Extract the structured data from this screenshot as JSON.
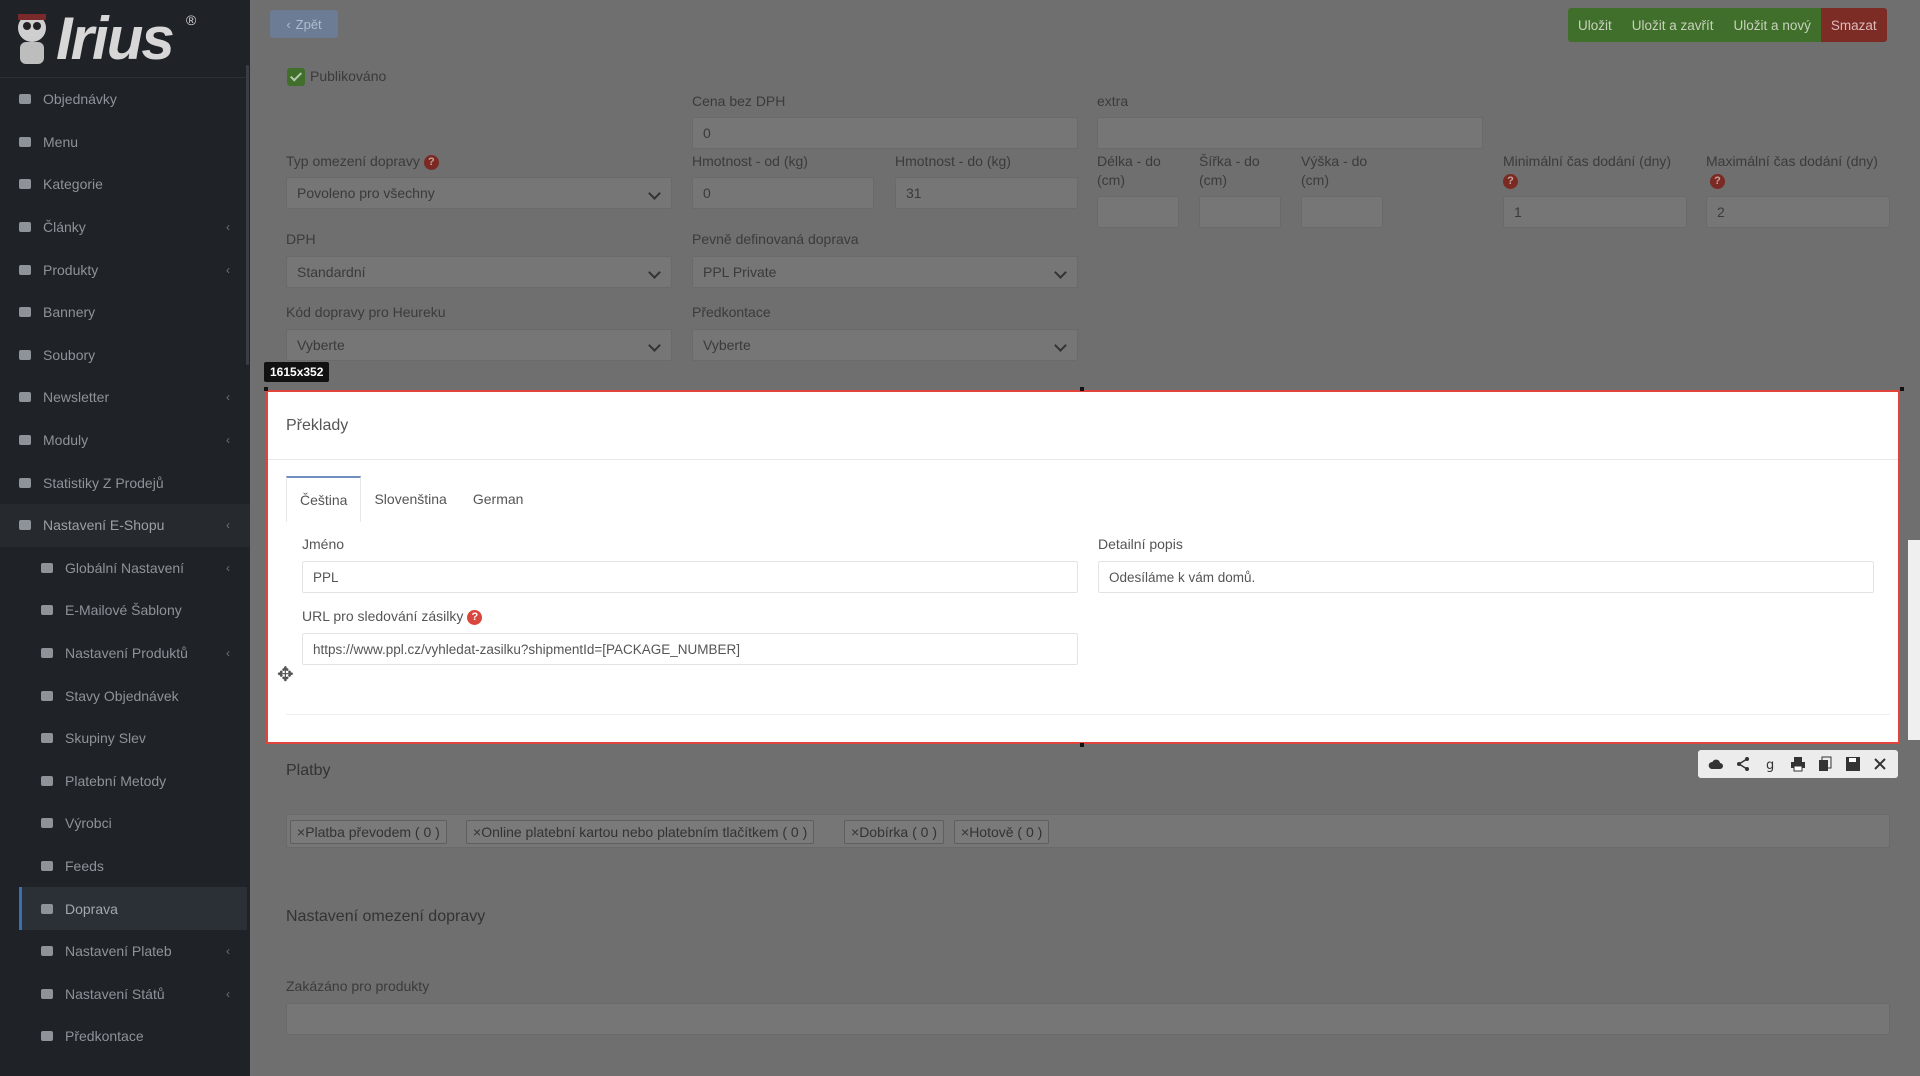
{
  "logo": {
    "text": "Irius",
    "reg": "®"
  },
  "sidebar": {
    "items": [
      {
        "label": "Objednávky",
        "icon": "cart-icon",
        "chevron": false
      },
      {
        "label": "Menu",
        "icon": "folder-icon",
        "chevron": false
      },
      {
        "label": "Kategorie",
        "icon": "list-icon",
        "chevron": false
      },
      {
        "label": "Články",
        "icon": "pencil-icon",
        "chevron": true
      },
      {
        "label": "Produkty",
        "icon": "dribbble-icon",
        "chevron": true
      },
      {
        "label": "Bannery",
        "icon": "image-icon",
        "chevron": false
      },
      {
        "label": "Soubory",
        "icon": "file-icon",
        "chevron": false
      },
      {
        "label": "Newsletter",
        "icon": "envelope-circle-icon",
        "chevron": true
      },
      {
        "label": "Moduly",
        "icon": "puzzle-icon",
        "chevron": true
      },
      {
        "label": "Statistiky Z Prodejů",
        "icon": "chart-icon",
        "chevron": false
      },
      {
        "label": "Nastavení E-Shopu",
        "icon": "settings-icon",
        "chevron": true
      }
    ],
    "subitems": [
      {
        "label": "Globální Nastavení",
        "icon": "gear-icon",
        "chevron": true
      },
      {
        "label": "E-Mailové Šablony",
        "icon": "mail-icon",
        "chevron": false
      },
      {
        "label": "Nastavení Produktů",
        "icon": "dribbble-icon",
        "chevron": true
      },
      {
        "label": "Stavy Objednávek",
        "icon": "flask-icon",
        "chevron": false
      },
      {
        "label": "Skupiny Slev",
        "icon": "tag-icon",
        "chevron": false
      },
      {
        "label": "Platební Metody",
        "icon": "card-icon",
        "chevron": false
      },
      {
        "label": "Výrobci",
        "icon": "building-icon",
        "chevron": false
      },
      {
        "label": "Feeds",
        "icon": "rss-icon",
        "chevron": false
      },
      {
        "label": "Doprava",
        "icon": "truck-icon",
        "chevron": false
      },
      {
        "label": "Nastavení Plateb",
        "icon": "card-icon",
        "chevron": true
      },
      {
        "label": "Nastavení Států",
        "icon": "flag-icon",
        "chevron": true
      },
      {
        "label": "Předkontace",
        "icon": "file-icon",
        "chevron": false
      }
    ]
  },
  "header": {
    "back_label": "Zpět",
    "actions": {
      "save": "Uložit",
      "save_close": "Uložit a zavřít",
      "save_new": "Uložit a nový",
      "delete": "Smazat"
    }
  },
  "form": {
    "published_label": "Publikováno",
    "price_label": "Cena bez DPH",
    "price_value": "0",
    "extra_label": "extra",
    "extra_value": "",
    "restriction_label": "Typ omezení dopravy",
    "restriction_value": "Povoleno pro všechny",
    "weight_from_label": "Hmotnost - od (kg)",
    "weight_from_value": "0",
    "weight_to_label": "Hmotnost - do (kg)",
    "weight_to_value": "31",
    "length_label": "Délka - do (cm)",
    "width_label": "Šířka - do (cm)",
    "height_label": "Výška - do (cm)",
    "min_time_label": "Minimální čas dodání (dny)",
    "min_time_value": "1",
    "max_time_label": "Maximální čas dodání (dny)",
    "max_time_value": "2",
    "vat_label": "DPH",
    "vat_value": "Standardní",
    "fixed_label": "Pevně definovaná doprava",
    "fixed_value": "PPL Private",
    "heureka_label": "Kód dopravy pro Heureku",
    "heureka_value": "Vyberte",
    "precontact_label": "Předkontace",
    "precontact_value": "Vyberte"
  },
  "overlay": {
    "size": "1615x352"
  },
  "translations": {
    "title": "Překlady",
    "tabs": [
      "Čeština",
      "Slovenština",
      "German"
    ],
    "name_label": "Jméno",
    "name_value": "PPL",
    "desc_label": "Detailní popis",
    "desc_value": "Odesíláme k vám domů.",
    "url_label": "URL pro sledování zásilky",
    "url_value": "https://www.ppl.cz/vyhledat-zasilku?shipmentId=[PACKAGE_NUMBER]"
  },
  "payments": {
    "title": "Platby",
    "tags": [
      "Platba převodem ( 0 )",
      "Online platební kartou nebo platebním tlačítkem ( 0 )",
      "Dobírka ( 0 )",
      "Hotově ( 0 )"
    ]
  },
  "restrictions": {
    "title": "Nastavení omezení dopravy",
    "forbidden_label": "Zakázáno pro produkty"
  }
}
